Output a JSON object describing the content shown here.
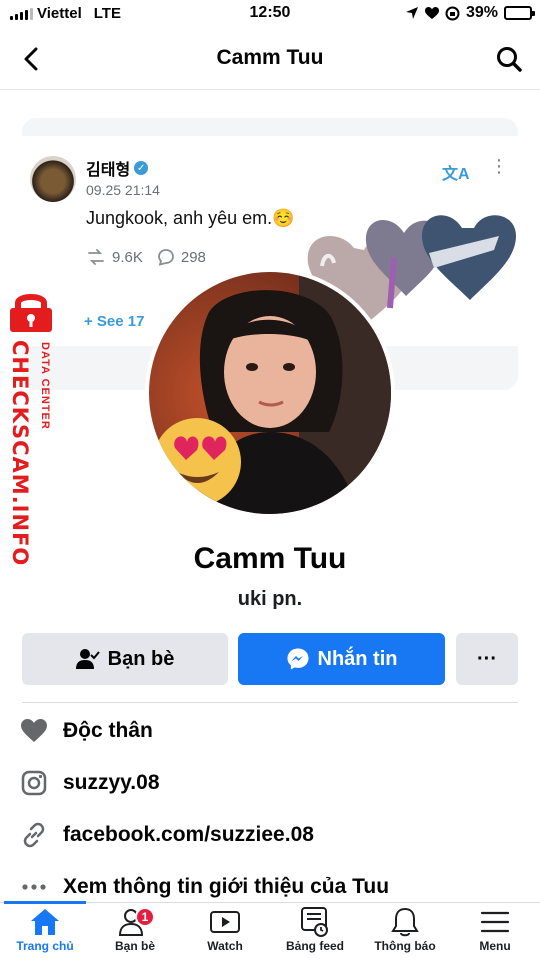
{
  "status_bar": {
    "carrier": "Viettel",
    "network": "LTE",
    "time": "12:50",
    "battery_percent": "39%",
    "battery_level": 0.39
  },
  "header": {
    "title": "Camm Tuu",
    "back_icon": "chevron-left-icon",
    "search_icon": "search-icon"
  },
  "cover_post": {
    "author": "김태형",
    "timestamp": "09.25 21:14",
    "text": "Jungkook, anh yêu em.☺️",
    "retweets": "9.6K",
    "replies": "298",
    "see_more": "+ See 17"
  },
  "watermark": {
    "main": "CHECKSCAM.INFO",
    "sub": "DATA CENTER"
  },
  "profile": {
    "name": "Camm Tuu",
    "bio": "uki pn."
  },
  "actions": {
    "friends_label": "Bạn bè",
    "message_label": "Nhắn tin",
    "more_label": "···"
  },
  "details": [
    {
      "icon": "heart-icon",
      "text": "Độc thân"
    },
    {
      "icon": "instagram-icon",
      "text": "suzzyy.08"
    },
    {
      "icon": "link-icon",
      "text": "facebook.com/suzziee.08"
    },
    {
      "icon": "more-dots-icon",
      "text": "Xem thông tin giới thiệu của Tuu"
    }
  ],
  "tabs": [
    {
      "label": "Trang chủ",
      "icon": "home-icon",
      "active": true
    },
    {
      "label": "Bạn bè",
      "icon": "friends-icon",
      "badge": "1"
    },
    {
      "label": "Watch",
      "icon": "watch-icon"
    },
    {
      "label": "Bảng feed",
      "icon": "feed-icon"
    },
    {
      "label": "Thông báo",
      "icon": "bell-icon"
    },
    {
      "label": "Menu",
      "icon": "menu-icon"
    }
  ],
  "colors": {
    "brand_blue": "#1877f2",
    "badge_red": "#e41e3f",
    "watermark_red": "#e31d1d",
    "twitter_blue": "#3a9bd8"
  }
}
